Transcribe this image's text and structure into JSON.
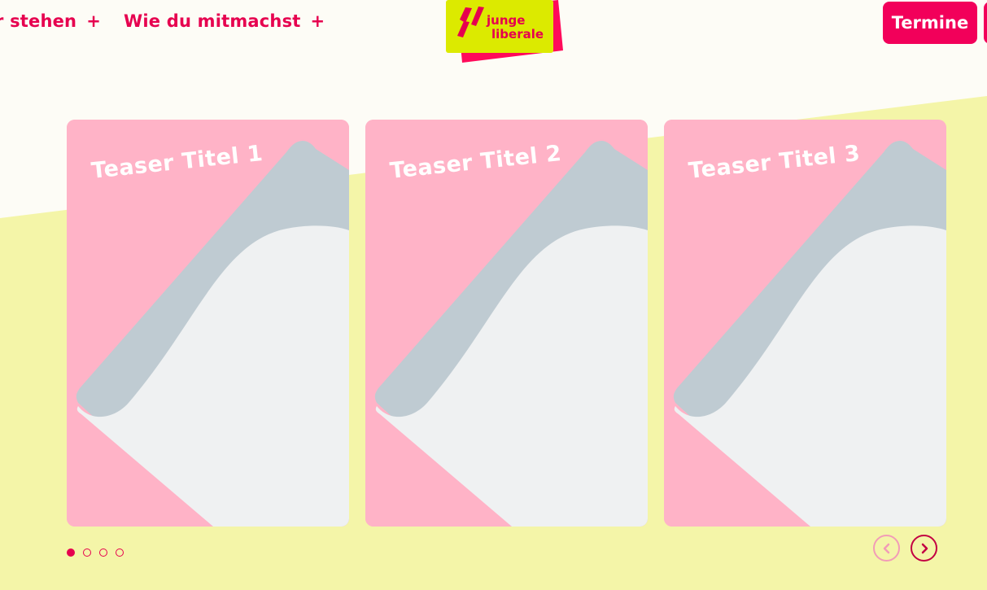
{
  "nav": {
    "items": [
      {
        "label": "r stehen",
        "plus": "+"
      },
      {
        "label": "Wie du mitmachst",
        "plus": "+"
      }
    ],
    "logo": {
      "line1": "junge",
      "line2": "liberale"
    },
    "cta_label": "Termine"
  },
  "slider": {
    "cards": [
      {
        "title": "Teaser Titel 1"
      },
      {
        "title": "Teaser Titel 2"
      },
      {
        "title": "Teaser Titel 3"
      }
    ],
    "active_dot": 0,
    "dot_count": 4
  },
  "colors": {
    "accent": "#e6004f",
    "background": "#fdfcf6",
    "band": "#f4f5a8",
    "card_bg": "#ffb3c7",
    "logo_yellow": "#dcea00"
  },
  "icons": {
    "prev": "chevron-left-icon",
    "next": "chevron-right-icon",
    "nav_expand": "plus-icon"
  }
}
